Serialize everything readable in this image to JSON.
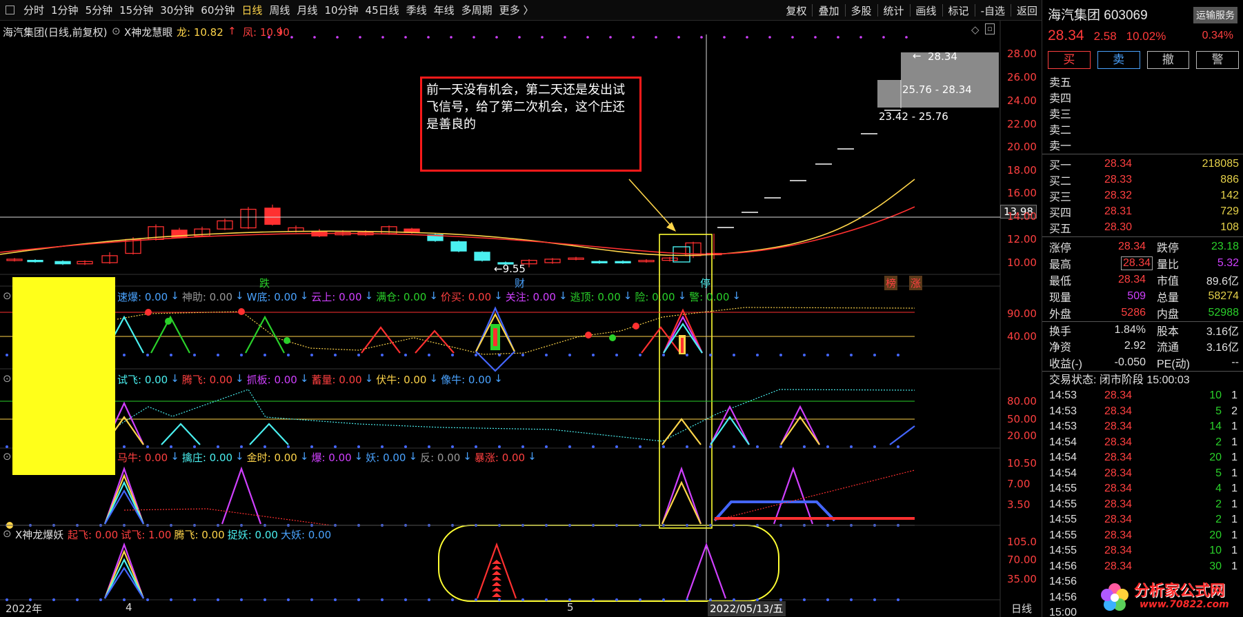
{
  "toolbar": {
    "periods": [
      "分时",
      "1分钟",
      "5分钟",
      "15分钟",
      "30分钟",
      "60分钟",
      "日线",
      "周线",
      "月线",
      "10分钟",
      "45日线",
      "季线",
      "年线",
      "多周期",
      "更多 〉"
    ],
    "active_index": 6,
    "right_items": [
      "复权",
      "叠加",
      "多股",
      "统计",
      "画线",
      "标记",
      "-自选",
      "返回"
    ]
  },
  "chart": {
    "title": "海汽集团(日线,前复权)",
    "indicator_name": "X神龙慧眼",
    "dragon_label": "龙: 10.82",
    "phoenix_label": "凤: 10.90",
    "crosshair_value": "13.98",
    "price_axis": [
      "28.00",
      "26.00",
      "24.00",
      "22.00",
      "20.00",
      "18.00",
      "16.00",
      "14.00",
      "12.00",
      "10.00"
    ],
    "low_marker": "9.55",
    "resistance_labels": [
      "28.34",
      "25.76 - 28.34",
      "23.42 - 25.76"
    ],
    "annotation": "前一天没有机会，第二天还是发出试飞信号，给了第二次机会，这个庄还是善良的",
    "signal_labels": [
      "跌",
      "财",
      "停",
      "榜",
      "涨"
    ],
    "panel1": {
      "items": [
        "速爆: 0.00",
        "神助: 0.00",
        "W底: 0.00",
        "云上: 0.00",
        "满仓: 0.00",
        "价买: 0.00",
        "关注: 0.00",
        "逃顶: 0.00",
        "险: 0.00",
        "警: 0.00"
      ],
      "axis": [
        "90.00",
        "40.00"
      ]
    },
    "panel2": {
      "items": [
        "试飞: 0.00",
        "腾飞: 0.00",
        "抓板: 0.00",
        "蓄量: 0.00",
        "伏牛: 0.00",
        "像牛: 0.00"
      ],
      "axis": [
        "80.00",
        "50.00",
        "20.00"
      ]
    },
    "panel3": {
      "items": [
        "马牛: 0.00",
        "擒庄: 0.00",
        "金时: 0.00",
        "爆: 0.00",
        "妖: 0.00",
        "反: 0.00",
        "暴涨: 0.00"
      ],
      "axis": [
        "10.50",
        "7.00",
        "3.50"
      ]
    },
    "panel4": {
      "name": "X神龙爆妖",
      "items": [
        "起飞: 0.00",
        "试飞: 1.00",
        "腾飞: 0.00",
        "捉妖: 0.00",
        "大妖: 0.00"
      ],
      "axis": [
        "105.0",
        "70.00",
        "35.00"
      ]
    },
    "date_axis": [
      "2022年",
      "4",
      "5"
    ],
    "date_cursor": "2022/05/13/五",
    "period_label": "日线"
  },
  "quote": {
    "name": "海汽集团 603069",
    "service": "运输服务",
    "price": "28.34",
    "change": "2.58",
    "change_pct": "10.02%",
    "turnover_pct": "0.34%",
    "buttons": [
      "买",
      "卖",
      "撤",
      "警"
    ],
    "asks": [
      {
        "label": "卖五",
        "price": "",
        "vol": ""
      },
      {
        "label": "卖四",
        "price": "",
        "vol": ""
      },
      {
        "label": "卖三",
        "price": "",
        "vol": ""
      },
      {
        "label": "卖二",
        "price": "",
        "vol": ""
      },
      {
        "label": "卖一",
        "price": "",
        "vol": ""
      }
    ],
    "bids": [
      {
        "label": "买一",
        "price": "28.34",
        "vol": "218085"
      },
      {
        "label": "买二",
        "price": "28.33",
        "vol": "886"
      },
      {
        "label": "买三",
        "price": "28.32",
        "vol": "142"
      },
      {
        "label": "买四",
        "price": "28.31",
        "vol": "729"
      },
      {
        "label": "买五",
        "price": "28.30",
        "vol": "108"
      }
    ],
    "stats": [
      {
        "k": "涨停",
        "v": "28.34",
        "vc": "#ff4040",
        "k2": "跌停",
        "v2": "23.18",
        "v2c": "#2ad12a"
      },
      {
        "k": "最高",
        "v": "28.34",
        "vc": "#ff4040",
        "k2": "量比",
        "v2": "5.32",
        "v2c": "#d040ff"
      },
      {
        "k": "最低",
        "v": "28.34",
        "vc": "#ff4040",
        "k2": "市值",
        "v2": "89.6亿",
        "v2c": "#e0e0e0"
      },
      {
        "k": "现量",
        "v": "509",
        "vc": "#d040ff",
        "k2": "总量",
        "v2": "58274",
        "v2c": "#e6d24a"
      },
      {
        "k": "外盘",
        "v": "5286",
        "vc": "#ff4040",
        "k2": "内盘",
        "v2": "52988",
        "v2c": "#2ad12a"
      },
      {
        "k": "换手",
        "v": "1.84%",
        "vc": "#e0e0e0",
        "k2": "股本",
        "v2": "3.16亿",
        "v2c": "#e0e0e0"
      },
      {
        "k": "净资",
        "v": "2.92",
        "vc": "#e0e0e0",
        "k2": "流通",
        "v2": "3.16亿",
        "v2c": "#e0e0e0"
      },
      {
        "k": "收益(-)",
        "v": "-0.050",
        "vc": "#e0e0e0",
        "k2": "PE(动)",
        "v2": "--",
        "v2c": "#e0e0e0"
      }
    ],
    "trade_state": "交易状态: 闭市阶段 15:00:03",
    "ticks": [
      {
        "t": "14:53",
        "p": "28.34",
        "v": "10",
        "n": "1"
      },
      {
        "t": "14:53",
        "p": "28.34",
        "v": "5",
        "n": "2"
      },
      {
        "t": "14:53",
        "p": "28.34",
        "v": "14",
        "n": "1"
      },
      {
        "t": "14:54",
        "p": "28.34",
        "v": "2",
        "n": "1"
      },
      {
        "t": "14:54",
        "p": "28.34",
        "v": "20",
        "n": "1"
      },
      {
        "t": "14:54",
        "p": "28.34",
        "v": "5",
        "n": "1"
      },
      {
        "t": "14:55",
        "p": "28.34",
        "v": "4",
        "n": "1"
      },
      {
        "t": "14:55",
        "p": "28.34",
        "v": "2",
        "n": "1"
      },
      {
        "t": "14:55",
        "p": "28.34",
        "v": "2",
        "n": "1"
      },
      {
        "t": "14:55",
        "p": "28.34",
        "v": "20",
        "n": "1"
      },
      {
        "t": "14:55",
        "p": "28.34",
        "v": "10",
        "n": "1"
      },
      {
        "t": "14:56",
        "p": "28.34",
        "v": "30",
        "n": "1"
      },
      {
        "t": "14:56",
        "p": "",
        "v": "",
        "n": ""
      },
      {
        "t": "14:56",
        "p": "",
        "v": "",
        "n": ""
      },
      {
        "t": "15:00",
        "p": "",
        "v": "",
        "n": ""
      }
    ],
    "watermark": "分析家公式网",
    "watermark_url": "www.70822.com"
  }
}
